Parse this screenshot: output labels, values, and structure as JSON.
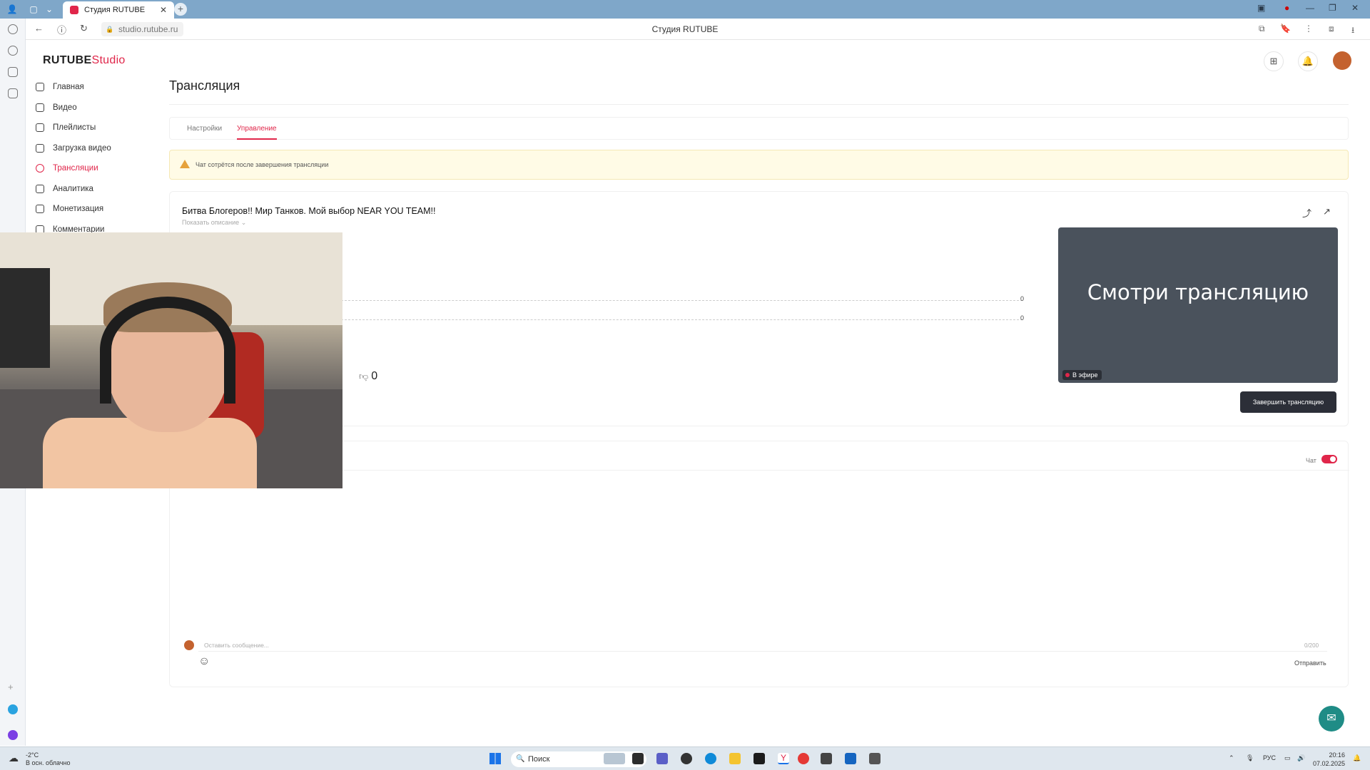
{
  "browser": {
    "tab_title": "Студия RUTUBE",
    "url": "studio.rutube.ru",
    "page_title": "Студия RUTUBE"
  },
  "app": {
    "logo_main": "RUTUBE",
    "logo_sub": "Studio"
  },
  "sidebar": {
    "items": [
      {
        "label": "Главная",
        "icon": "home-icon"
      },
      {
        "label": "Видео",
        "icon": "video-icon"
      },
      {
        "label": "Плейлисты",
        "icon": "list-icon"
      },
      {
        "label": "Загрузка видео",
        "icon": "upload-icon"
      },
      {
        "label": "Трансляции",
        "icon": "broadcast-icon",
        "active": true
      },
      {
        "label": "Аналитика",
        "icon": "chart-icon"
      },
      {
        "label": "Монетизация",
        "icon": "coin-icon"
      },
      {
        "label": "Комментарии",
        "icon": "comment-icon"
      }
    ]
  },
  "main": {
    "page_title": "Трансляция",
    "tabs": [
      {
        "label": "Настройки"
      },
      {
        "label": "Управление",
        "active": true
      }
    ],
    "warning": "Чат сотрётся после завершения трансляции",
    "stream": {
      "title": "Битва Блогеров!! Мир Танков. Мой выбор NEAR YOU TEAM!!",
      "show_description": "Показать описание",
      "stat_values": [
        "0",
        "0"
      ],
      "dislikes": "0",
      "preview_text": "Смотри трансляцию",
      "live_badge": "В эфире",
      "end_button": "Завершить трансляцию"
    },
    "chat": {
      "toggle_label": "Чат",
      "toggle_on": true,
      "message_placeholder": "Оставить сообщение...",
      "counter": "0/200",
      "send_label": "Отправить"
    }
  },
  "taskbar": {
    "weather_temp": "-2°C",
    "weather_desc": "В осн. облачно",
    "search_label": "Поиск",
    "lang": "РУС",
    "time": "20:16",
    "date": "07.02.2025"
  },
  "colors": {
    "accent": "#e0264a",
    "dark_button": "#2c2f38",
    "preview_bg": "#4a525c"
  }
}
